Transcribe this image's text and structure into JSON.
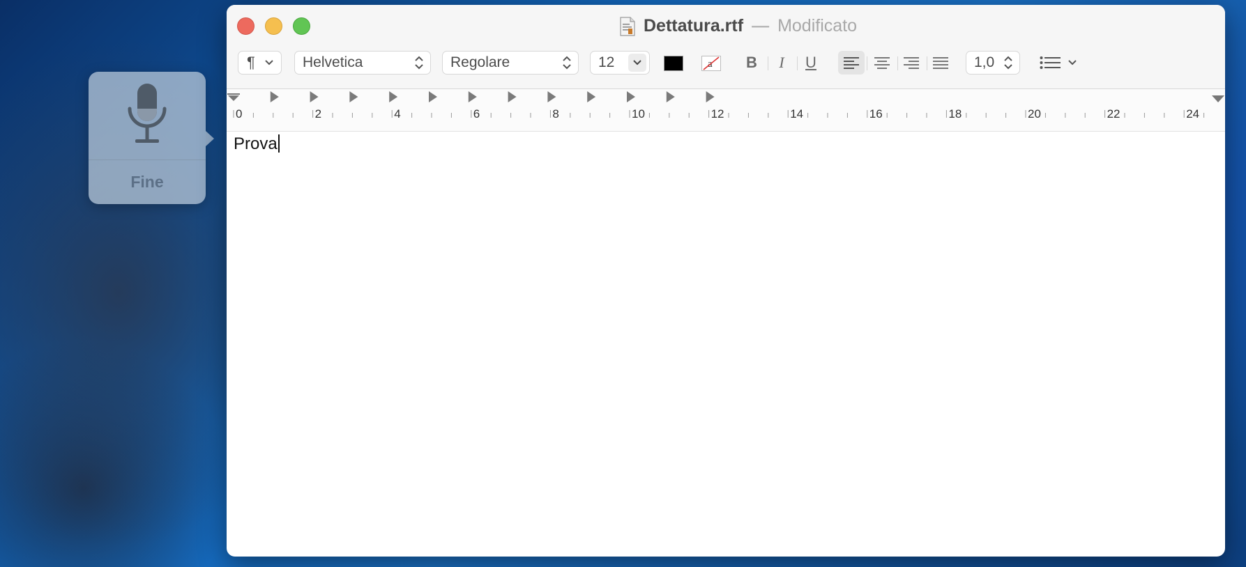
{
  "dictation": {
    "done_label": "Fine"
  },
  "window": {
    "filename": "Dettatura.rtf",
    "separator": "—",
    "status": "Modificato"
  },
  "toolbar": {
    "paragraph_icon": "¶",
    "font_family": "Helvetica",
    "font_style": "Regolare",
    "font_size": "12",
    "text_color": "#000000",
    "bold": "B",
    "italic": "I",
    "underline": "U",
    "line_spacing": "1,0"
  },
  "ruler": {
    "labels": [
      "0",
      "2",
      "4",
      "6",
      "8",
      "10",
      "12",
      "14",
      "16",
      "18",
      "20",
      "22",
      "24"
    ]
  },
  "document": {
    "text": "Prova"
  }
}
